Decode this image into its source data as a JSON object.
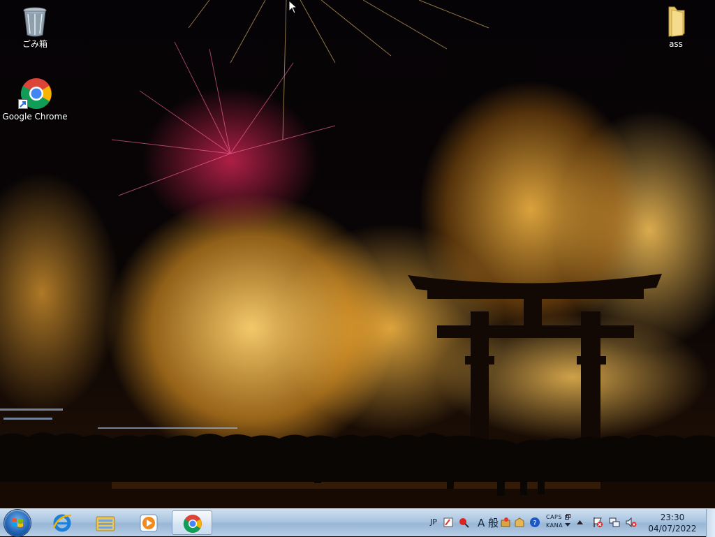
{
  "desktop": {
    "icons": [
      {
        "label": "ごみ箱",
        "icon": "recycle-bin-icon"
      },
      {
        "label": "Google Chrome",
        "icon": "chrome-icon"
      },
      {
        "label": "ass",
        "icon": "folder-icon"
      }
    ]
  },
  "taskbar": {
    "start": "windows-start-icon",
    "pinned": [
      {
        "app": "Internet Explorer",
        "icon": "internet-explorer-icon"
      },
      {
        "app": "Windows Explorer",
        "icon": "file-explorer-icon"
      },
      {
        "app": "Windows Media Player",
        "icon": "media-player-icon"
      },
      {
        "app": "Google Chrome",
        "icon": "chrome-icon",
        "active": true
      }
    ]
  },
  "tray": {
    "language": "JP",
    "ime_mode": "A 般",
    "caps": "CAPS",
    "kana": "KANA",
    "time": "23:30",
    "date": "04/07/2022"
  },
  "colors": {
    "taskbar": "#a9c4df",
    "chrome_red": "#db4437",
    "chrome_green": "#0f9d58",
    "chrome_yellow": "#f4b400",
    "chrome_blue": "#4285f4"
  }
}
